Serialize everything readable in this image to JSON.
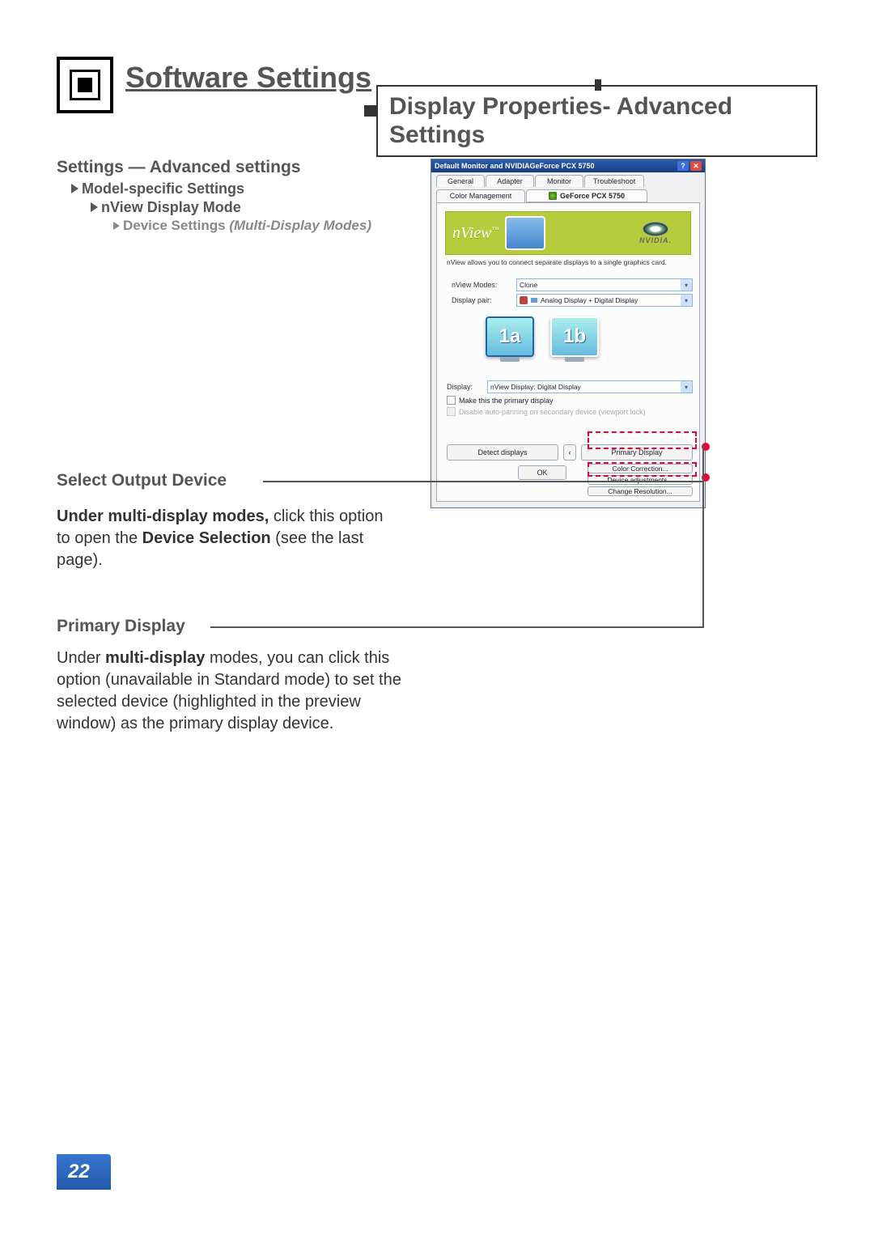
{
  "header": {
    "main_title": "Software Settings",
    "sub_title": "Display Properties- Advanced Settings"
  },
  "breadcrumb": {
    "l1": "Settings — Advanced settings",
    "l2": "Model-specific Settings",
    "l3": "nView Display Mode",
    "l4_prefix": "Device Settings ",
    "l4_italic": "(Multi-Display Modes)"
  },
  "dialog": {
    "titlebar": "Default Monitor and NVIDIAGeForce PCX 5750",
    "tabs_row1": [
      "General",
      "Adapter",
      "Monitor",
      "Troubleshoot"
    ],
    "tab_color_mgmt": "Color Management",
    "tab_geforce": "GeForce PCX 5750",
    "nview_label": "nView™",
    "nvidia_label": "NVIDIA.",
    "nview_desc": "nView allows you to connect separate displays to a single graphics card.",
    "nview_modes_label": "nView Modes:",
    "nview_modes_value": "Clone",
    "display_pair_label": "Display pair:",
    "display_pair_value": "Analog Display + Digital Display",
    "preview_1": "1a",
    "preview_2": "1b",
    "display_label": "Display:",
    "display_value": "nView Display: Digital Display",
    "chk_primary": "Make this the primary display",
    "chk_disable": "Disable auto-panning on secondary device (viewport lock)",
    "btn_detect": "Detect displays",
    "btn_primary": "Primary Display",
    "btn_ok": "OK",
    "btn_color": "Color Correction...",
    "btn_device": "Device adjustments...",
    "btn_res": "Change Resolution..."
  },
  "callouts": {
    "select_output": "Select Output Device",
    "select_output_body": "Under multi-display modes, click this option to open the Device Selection (see the last page).",
    "primary_display": "Primary Display",
    "primary_display_body": "Under multi-display modes, you can click this option (unavailable in Standard mode) to set the selected device (highlighted in the preview window) as the primary display device."
  },
  "page_number": "22"
}
